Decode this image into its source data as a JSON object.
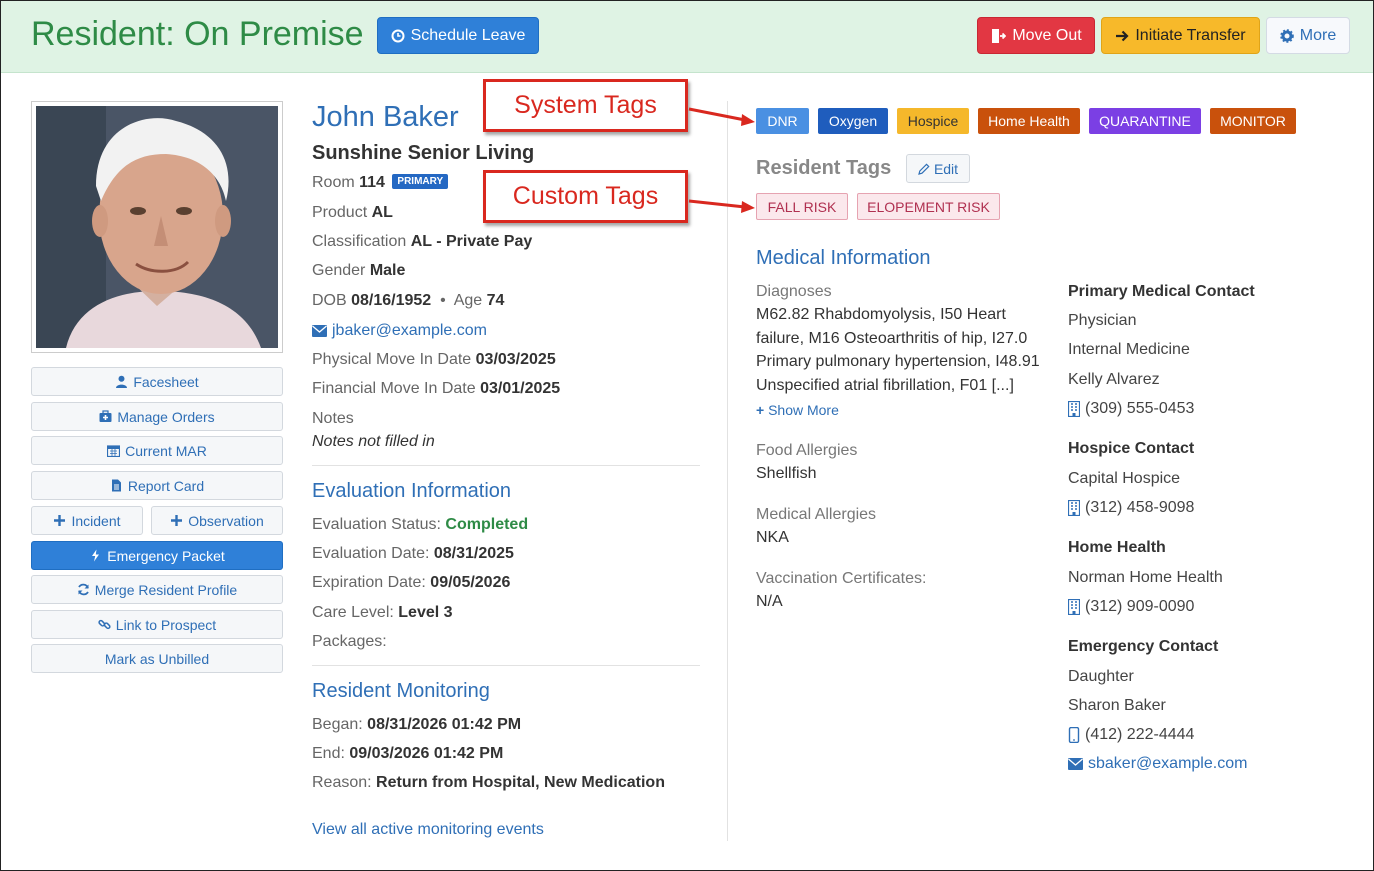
{
  "header": {
    "title": "Resident: On Premise",
    "schedule_leave": "Schedule Leave",
    "move_out": "Move Out",
    "initiate_transfer": "Initiate Transfer",
    "more": "More"
  },
  "sidebar": {
    "facesheet": "Facesheet",
    "manage_orders": "Manage Orders",
    "current_mar": "Current MAR",
    "report_card": "Report Card",
    "incident": "Incident",
    "observation": "Observation",
    "emergency_packet": "Emergency Packet",
    "merge_profile": "Merge Resident Profile",
    "link_prospect": "Link to Prospect",
    "mark_unbilled": "Mark as Unbilled"
  },
  "resident": {
    "name": "John Baker",
    "facility": "Sunshine Senior Living",
    "room_label": "Room",
    "room": "114",
    "room_badge": "PRIMARY",
    "product_label": "Product",
    "product": "AL",
    "classification_label": "Classification",
    "classification": "AL - Private Pay",
    "gender_label": "Gender",
    "gender": "Male",
    "dob_label": "DOB",
    "dob": "08/16/1952",
    "age_label": "Age",
    "age": "74",
    "email": "jbaker@example.com",
    "physical_move_label": "Physical Move In Date",
    "physical_move": "03/03/2025",
    "financial_move_label": "Financial Move In Date",
    "financial_move": "03/01/2025",
    "notes_label": "Notes",
    "notes": "Notes not filled in"
  },
  "evaluation": {
    "title": "Evaluation Information",
    "status_label": "Evaluation Status:",
    "status": "Completed",
    "date_label": "Evaluation Date:",
    "date": "08/31/2025",
    "expiration_label": "Expiration Date:",
    "expiration": "09/05/2026",
    "care_label": "Care Level:",
    "care": "Level 3",
    "packages_label": "Packages:"
  },
  "monitoring": {
    "title": "Resident Monitoring",
    "began_label": "Began:",
    "began": "08/31/2026 01:42 PM",
    "end_label": "End:",
    "end": "09/03/2026 01:42 PM",
    "reason_label": "Reason:",
    "reason": "Return from Hospital, New Medication",
    "view_all": "View all active monitoring events"
  },
  "tags": {
    "system": [
      "DNR",
      "Oxygen",
      "Hospice",
      "Home Health",
      "QUARANTINE",
      "MONITOR"
    ],
    "resident_tags_title": "Resident Tags",
    "edit": "Edit",
    "custom": [
      "FALL RISK",
      "ELOPEMENT RISK"
    ],
    "callout_system": "System Tags",
    "callout_custom": "Custom Tags"
  },
  "medical": {
    "title": "Medical Information",
    "diagnoses_label": "Diagnoses",
    "diagnoses_lines": [
      "M62.82 Rhabdomyolysis, I50 Heart",
      "failure, M16 Osteoarthritis of hip, I27.0",
      "Primary pulmonary hypertension, I48.91",
      "Unspecified atrial fibrillation, F01 [...]"
    ],
    "show_more": "Show More",
    "food_label": "Food Allergies",
    "food": "Shellfish",
    "med_allergies_label": "Medical Allergies",
    "med_allergies": "NKA",
    "vacc_label": "Vaccination Certificates:",
    "vacc": "N/A"
  },
  "contacts": {
    "primary_title": "Primary Medical Contact",
    "primary_role": "Physician",
    "primary_dept": "Internal Medicine",
    "primary_name": "Kelly Alvarez",
    "primary_phone": "(309) 555-0453",
    "hospice_title": "Hospice Contact",
    "hospice_name": "Capital Hospice",
    "hospice_phone": "(312) 458-9098",
    "hh_title": "Home Health",
    "hh_name": "Norman Home Health",
    "hh_phone": "(312) 909-0090",
    "emergency_title": "Emergency Contact",
    "emergency_relation": "Daughter",
    "emergency_name": "Sharon Baker",
    "emergency_phone": "(412) 222-4444",
    "emergency_email": "sbaker@example.com"
  }
}
